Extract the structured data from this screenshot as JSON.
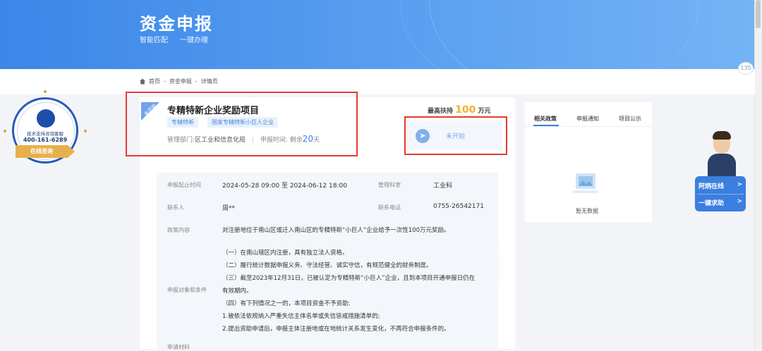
{
  "banner": {
    "title": "资金申报",
    "slogan_1": "智能匹配",
    "slogan_2": "一键办理"
  },
  "breadcrumb": {
    "home": "首页",
    "sep1": "-",
    "level2": "资金申报",
    "sep2": "-",
    "current": "详情页"
  },
  "counter_badge": "135",
  "help_seal": {
    "title": "技术支持咨询客服",
    "phone": "400-161-6289",
    "button": "在线咨询"
  },
  "project": {
    "status_ribbon": "未开始",
    "title": "专精特新企业奖励项目",
    "tags": [
      "专精特新",
      "国家专精特新小巨人企业"
    ],
    "dept_label": "管理部门:",
    "dept_value": "区工业和信息化局",
    "divider": "|",
    "time_label": "申报时间:",
    "time_prefix": "剩余",
    "time_days": "20",
    "time_suffix": "天",
    "max_support_label": "最高扶持",
    "max_support_value": "100",
    "max_support_unit": "万元",
    "status_button": "未开始"
  },
  "detail": {
    "period_label": "申报起止时间",
    "period_value": "2024-05-28 09:00 至 2024-06-12 18:00",
    "office_label": "管理科室",
    "office_value": "工业科",
    "contact_label": "联系人",
    "contact_value": "周**",
    "phone_label": "联系电话",
    "phone_value": "0755-26542171",
    "policy_label": "政策内容",
    "policy_value": "对注册地位于南山区或迁入南山区的专精特新“小巨人”企业给予一次性100万元奖励。",
    "conditions_label": "申报对象和条件",
    "conditions": [
      "（一）在南山辖区内注册，具有独立法人资格。",
      "（二）履行统计数据申报义务、守法经营、诚实守信，有规范健全的财务制度。",
      "（三）截至2023年12月31日，已被认定为专精特新“小巨人”企业，且到本项目开通申报日仍在",
      "有效期内。",
      "（四）有下列情况之一的，本项目资金不予资助:",
      "1.被依法依规纳入严重失信主体名单或失信惩戒措施清单的;",
      "2.提出资助申请后，申报主体注册地或在地统计关系发生变化，不再符合申报条件的。"
    ],
    "materials_label": "申请材料"
  },
  "sidebar": {
    "tabs": [
      "相关政策",
      "申报通知",
      "项目公示"
    ],
    "empty_text": "暂无数据"
  },
  "chat": {
    "online_label": "阿炳在线",
    "help_label": "一键求助",
    "arrow": ">"
  }
}
